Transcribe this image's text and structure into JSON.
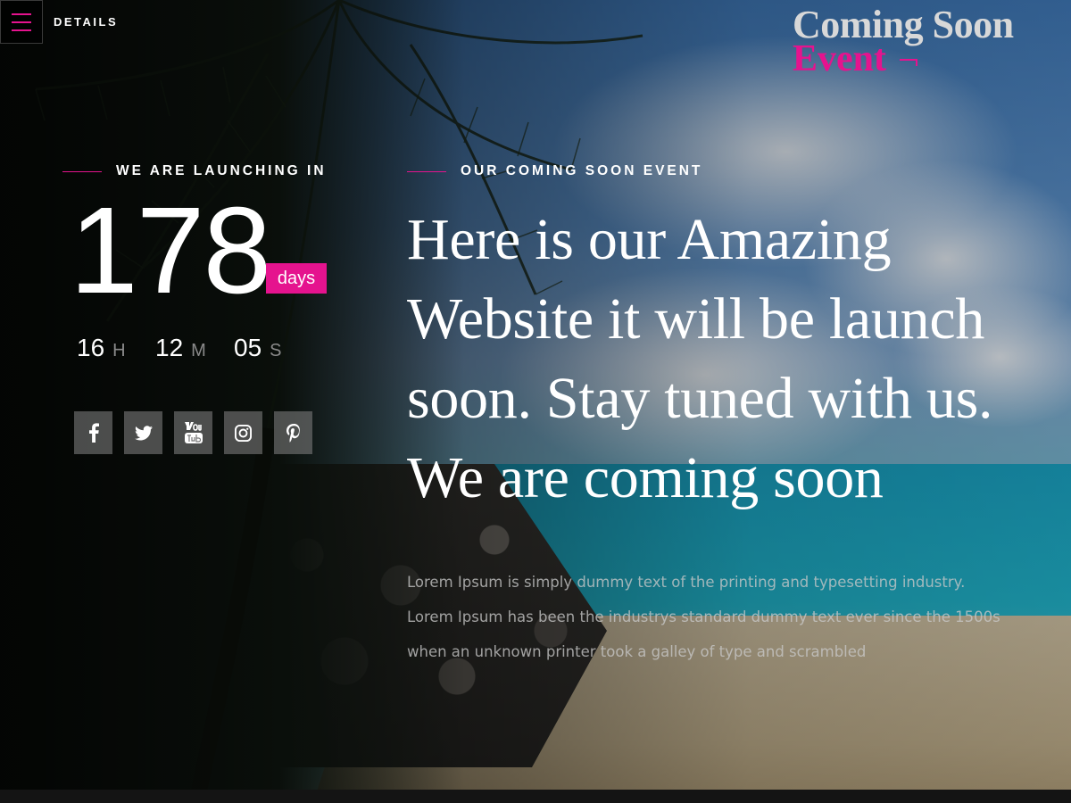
{
  "header": {
    "menu_icon": "hamburger-icon",
    "details_label": "DETAILS",
    "logo_line1": "Coming Soon",
    "logo_line2": "Event"
  },
  "countdown": {
    "section_label": "WE ARE LAUNCHING IN",
    "days_value": "178",
    "days_label": "days",
    "hours_value": "16",
    "hours_suffix": "H",
    "minutes_value": "12",
    "minutes_suffix": "M",
    "seconds_value": "05",
    "seconds_suffix": "S"
  },
  "social": [
    {
      "icon": "facebook-icon"
    },
    {
      "icon": "twitter-icon"
    },
    {
      "icon": "youtube-icon"
    },
    {
      "icon": "instagram-icon"
    },
    {
      "icon": "pinterest-icon"
    }
  ],
  "event": {
    "section_label": "OUR COMING SOON EVENT",
    "headline": "Here is our Amazing Website it will be launch soon. Stay tuned with us. We are coming soon",
    "body": "Lorem Ipsum is simply dummy text of the printing and typesetting industry. Lorem Ipsum has been the industrys standard dummy text ever since the 1500s when an unknown printer took a galley of type and scrambled"
  },
  "colors": {
    "accent": "#e5138e",
    "text": "#ffffff",
    "muted": "#8a8a8a"
  }
}
